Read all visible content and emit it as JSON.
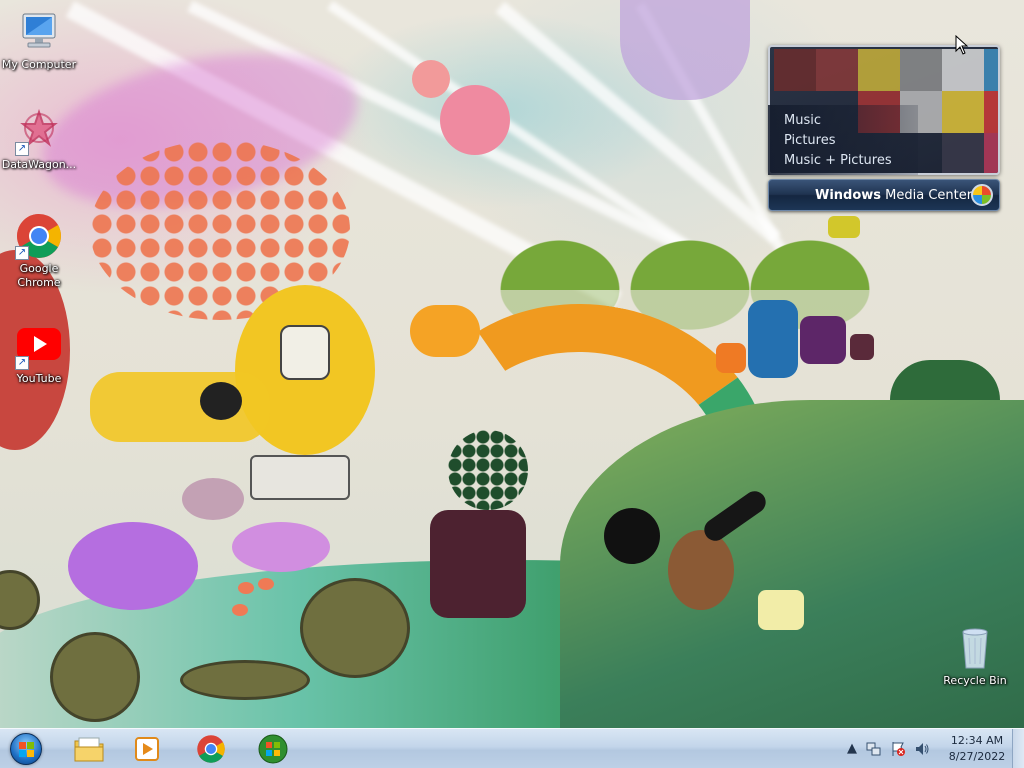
{
  "desktop": {
    "icons": [
      {
        "label": "My Computer",
        "icon": "computer-icon"
      },
      {
        "label": "DataWagon...",
        "icon": "datawagon-icon"
      },
      {
        "label": "Google Chrome",
        "icon": "chrome-icon"
      },
      {
        "label": "YouTube",
        "icon": "youtube-icon"
      },
      {
        "label": "Recycle Bin",
        "icon": "recycle-bin-icon"
      }
    ]
  },
  "media_center_gadget": {
    "menu": [
      "Music",
      "Pictures",
      "Music + Pictures"
    ],
    "brand_bold": "Windows",
    "brand_rest": " Media Center",
    "logo_icon": "windows-logo-icon"
  },
  "taskbar": {
    "start_icon": "windows-start-orb-icon",
    "pinned": [
      {
        "icon": "file-explorer-icon"
      },
      {
        "icon": "media-player-icon"
      },
      {
        "icon": "chrome-icon"
      },
      {
        "icon": "windows-media-center-icon"
      }
    ],
    "tray": {
      "icons": [
        "show-hidden-icons-icon",
        "network-icon",
        "action-center-icon",
        "volume-icon"
      ],
      "time": "12:34 AM",
      "date": "8/27/2022"
    }
  },
  "colors": {
    "taskbar": "#c3d5ea",
    "wmc_bar": "#1f3350",
    "youtube_red": "#ff0000"
  }
}
